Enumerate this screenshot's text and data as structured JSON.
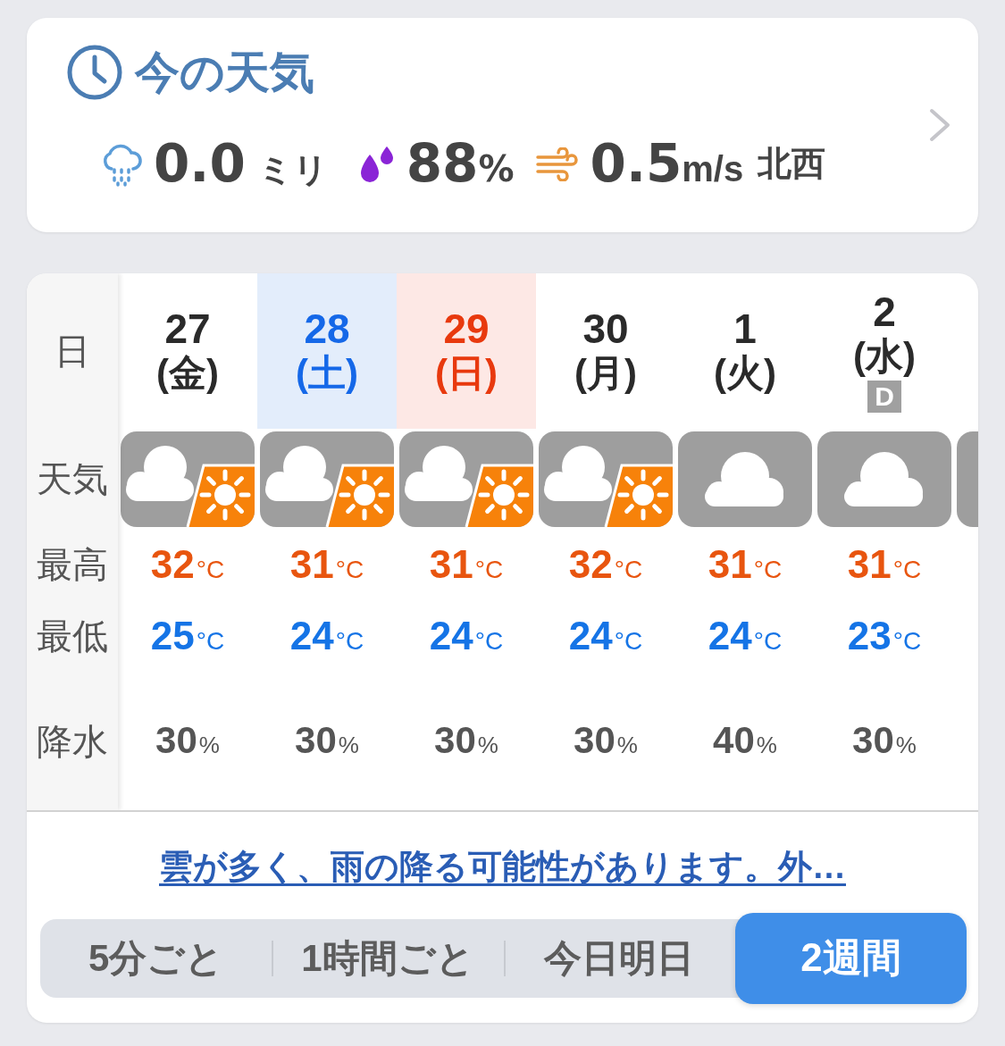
{
  "current": {
    "title": "今の天気",
    "stats": [
      {
        "kind": "rain",
        "value": "0.0",
        "unit": "ミリ"
      },
      {
        "kind": "humidity",
        "value": "88",
        "unit": "%"
      },
      {
        "kind": "wind",
        "value": "0.5",
        "unit": "m/s",
        "direction": "北西"
      }
    ]
  },
  "forecast": {
    "row_labels": [
      "日",
      "天気",
      "最高",
      "最低",
      "降水"
    ],
    "days": [
      {
        "date": "27",
        "weekday": "(金)",
        "kind": "weekday",
        "weather": {
          "kind": "cloud_sun"
        },
        "high": {
          "value": "32",
          "unit": "°C"
        },
        "low": {
          "value": "25",
          "unit": "°C"
        },
        "precip": {
          "value": "30",
          "unit": "%"
        }
      },
      {
        "date": "28",
        "weekday": "(土)",
        "kind": "saturday",
        "weather": {
          "kind": "cloud_sun"
        },
        "high": {
          "value": "31",
          "unit": "°C"
        },
        "low": {
          "value": "24",
          "unit": "°C"
        },
        "precip": {
          "value": "30",
          "unit": "%"
        }
      },
      {
        "date": "29",
        "weekday": "(日)",
        "kind": "sunday",
        "weather": {
          "kind": "cloud_sun"
        },
        "high": {
          "value": "31",
          "unit": "°C"
        },
        "low": {
          "value": "24",
          "unit": "°C"
        },
        "precip": {
          "value": "30",
          "unit": "%"
        }
      },
      {
        "date": "30",
        "weekday": "(月)",
        "kind": "weekday",
        "weather": {
          "kind": "cloud_sun"
        },
        "high": {
          "value": "32",
          "unit": "°C"
        },
        "low": {
          "value": "24",
          "unit": "°C"
        },
        "precip": {
          "value": "30",
          "unit": "%"
        }
      },
      {
        "date": "1",
        "weekday": "(火)",
        "kind": "weekday",
        "weather": {
          "kind": "cloud"
        },
        "high": {
          "value": "31",
          "unit": "°C"
        },
        "low": {
          "value": "24",
          "unit": "°C"
        },
        "precip": {
          "value": "40",
          "unit": "%"
        }
      },
      {
        "date": "2",
        "weekday": "(水)",
        "kind": "weekday",
        "badge": "D",
        "weather": {
          "kind": "cloud"
        },
        "high": {
          "value": "31",
          "unit": "°C"
        },
        "low": {
          "value": "23",
          "unit": "°C"
        },
        "precip": {
          "value": "30",
          "unit": "%"
        }
      }
    ],
    "summary_link": "雲が多く、雨の降る可能性があります。外…",
    "period_tabs": [
      {
        "label": "5分ごと",
        "selected": false
      },
      {
        "label": "1時間ごと",
        "selected": false
      },
      {
        "label": "今日明日",
        "selected": false
      },
      {
        "label": "2週間",
        "selected": true
      }
    ]
  }
}
